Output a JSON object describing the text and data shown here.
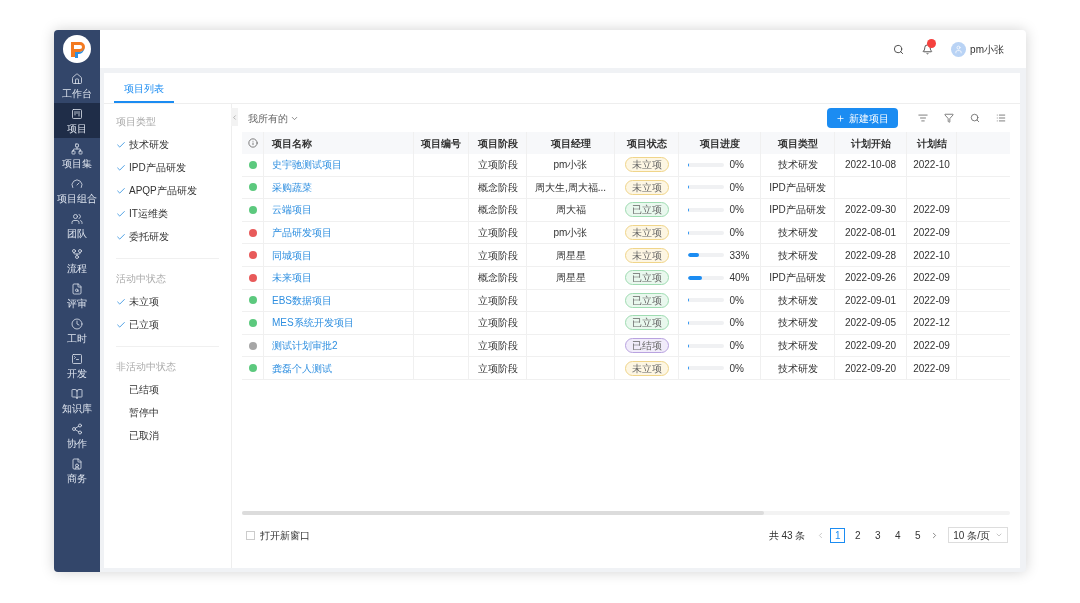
{
  "nav": [
    {
      "label": "工作台",
      "selected": false
    },
    {
      "label": "项目",
      "selected": true
    },
    {
      "label": "项目集",
      "selected": false
    },
    {
      "label": "项目组合",
      "selected": false
    },
    {
      "label": "团队",
      "selected": false
    },
    {
      "label": "流程",
      "selected": false
    },
    {
      "label": "评审",
      "selected": false
    },
    {
      "label": "工时",
      "selected": false
    },
    {
      "label": "开发",
      "selected": false
    },
    {
      "label": "知识库",
      "selected": false
    },
    {
      "label": "协作",
      "selected": false
    },
    {
      "label": "商务",
      "selected": false
    }
  ],
  "header": {
    "user": "pm小张"
  },
  "tabs": [
    {
      "label": "项目列表",
      "selected": true
    }
  ],
  "filters": [
    {
      "title": "项目类型",
      "items": [
        {
          "label": "技术研发",
          "checked": true
        },
        {
          "label": "IPD产品研发",
          "checked": true
        },
        {
          "label": "APQP产品研发",
          "checked": true
        },
        {
          "label": "IT运维类",
          "checked": true
        },
        {
          "label": "委托研发",
          "checked": true
        }
      ]
    },
    {
      "title": "活动中状态",
      "items": [
        {
          "label": "未立项",
          "checked": true
        },
        {
          "label": "已立项",
          "checked": true
        }
      ]
    },
    {
      "title": "非活动中状态",
      "items": [
        {
          "label": "已结项",
          "checked": false
        },
        {
          "label": "暂停中",
          "checked": false
        },
        {
          "label": "已取消",
          "checked": false
        }
      ]
    }
  ],
  "toolbar": {
    "scope": "我所有的",
    "new_button": "新建项目"
  },
  "table": {
    "columns": [
      "项目名称",
      "项目编号",
      "项目阶段",
      "项目经理",
      "项目状态",
      "项目进度",
      "项目类型",
      "计划开始",
      "计划结"
    ],
    "rows": [
      {
        "color": "#5cc97e",
        "name": "史宇驰测试项目",
        "stage": "立项阶段",
        "manager": "pm小张",
        "status": {
          "label": "未立项",
          "kind": "pending"
        },
        "level": 0,
        "progress": "0%",
        "type": "技术研发",
        "start": "2022-10-08",
        "end": "2022-10"
      },
      {
        "color": "#5cc97e",
        "name": "采购蔬菜",
        "stage": "概念阶段",
        "manager": "周大生,周大福...",
        "status": {
          "label": "未立项",
          "kind": "pending"
        },
        "level": 0,
        "progress": "0%",
        "type": "IPD产品研发"
      },
      {
        "color": "#5cc97e",
        "name": "云端项目",
        "stage": "概念阶段",
        "manager": "周大福",
        "status": {
          "label": "已立项",
          "kind": "approved"
        },
        "level": 0,
        "progress": "0%",
        "type": "IPD产品研发",
        "start": "2022-09-30",
        "end": "2022-09"
      },
      {
        "color": "#e85a5a",
        "name": "产品研发项目",
        "stage": "立项阶段",
        "manager": "pm小张",
        "status": {
          "label": "未立项",
          "kind": "pending"
        },
        "level": 0,
        "progress": "0%",
        "type": "技术研发",
        "start": "2022-08-01",
        "end": "2022-09"
      },
      {
        "color": "#e85a5a",
        "name": "同城项目",
        "stage": "立项阶段",
        "manager": "周星星",
        "status": {
          "label": "未立项",
          "kind": "pending"
        },
        "level": 0.33,
        "progress": "33%",
        "type": "技术研发",
        "start": "2022-09-28",
        "end": "2022-10"
      },
      {
        "color": "#e85a5a",
        "name": "未来项目",
        "stage": "概念阶段",
        "manager": "周星星",
        "status": {
          "label": "已立项",
          "kind": "approved"
        },
        "level": 0.4,
        "progress": "40%",
        "type": "IPD产品研发",
        "start": "2022-09-26",
        "end": "2022-09"
      },
      {
        "color": "#5cc97e",
        "name": "EBS数据项目",
        "stage": "立项阶段",
        "status": {
          "label": "已立项",
          "kind": "approved"
        },
        "level": 0,
        "progress": "0%",
        "type": "技术研发",
        "start": "2022-09-01",
        "end": "2022-09"
      },
      {
        "color": "#5cc97e",
        "name": "MES系统开发项目",
        "stage": "立项阶段",
        "status": {
          "label": "已立项",
          "kind": "approved"
        },
        "level": 0,
        "progress": "0%",
        "type": "技术研发",
        "start": "2022-09-05",
        "end": "2022-12"
      },
      {
        "color": "#a6a6a6",
        "name": "测试计划审批2",
        "stage": "立项阶段",
        "status": {
          "label": "已结项",
          "kind": "closed"
        },
        "level": 0,
        "progress": "0%",
        "type": "技术研发",
        "start": "2022-09-20",
        "end": "2022-09"
      },
      {
        "color": "#5cc97e",
        "name": "龚磊个人测试",
        "stage": "立项阶段",
        "status": {
          "label": "未立项",
          "kind": "pending"
        },
        "level": 0,
        "progress": "0%",
        "type": "技术研发",
        "start": "2022-09-20",
        "end": "2022-09"
      }
    ]
  },
  "footer": {
    "open_new_window": {
      "label": "打开新窗口",
      "checked": false
    },
    "total": "共 43 条",
    "pages": [
      {
        "label": "1",
        "selected": true
      },
      {
        "label": "2",
        "selected": false
      },
      {
        "label": "3",
        "selected": false
      },
      {
        "label": "4",
        "selected": false
      },
      {
        "label": "5",
        "selected": false
      }
    ],
    "page_size": "10 条/页"
  }
}
